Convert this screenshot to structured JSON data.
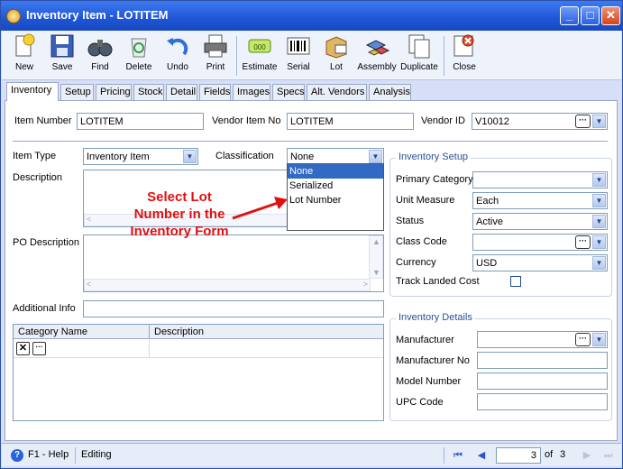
{
  "window": {
    "title": "Inventory Item - LOTITEM",
    "minimize_glyph": "_",
    "maximize_glyph": "□",
    "close_glyph": "✕"
  },
  "toolbar": {
    "new": "New",
    "save": "Save",
    "find": "Find",
    "delete": "Delete",
    "undo": "Undo",
    "print": "Print",
    "estimate": "Estimate",
    "serial": "Serial",
    "lot": "Lot",
    "assembly": "Assembly",
    "duplicate": "Duplicate",
    "close": "Close"
  },
  "tabs": [
    "Inventory",
    "Setup",
    "Pricing",
    "Stock",
    "Detail",
    "Fields",
    "Images",
    "Specs",
    "Alt. Vendors",
    "Analysis"
  ],
  "header_fields": {
    "item_number_label": "Item Number",
    "item_number_value": "LOTITEM",
    "vendor_item_no_label": "Vendor Item No",
    "vendor_item_no_value": "LOTITEM",
    "vendor_id_label": "Vendor ID",
    "vendor_id_value": "V10012"
  },
  "left_form": {
    "item_type_label": "Item Type",
    "item_type_value": "Inventory Item",
    "classification_label": "Classification",
    "classification_value": "None",
    "classification_options": [
      "None",
      "Serialized",
      "Lot Number"
    ],
    "description_label": "Description",
    "po_description_label": "PO Description",
    "additional_info_label": "Additional Info"
  },
  "annotation": {
    "line1": "Select Lot",
    "line2": "Number in the",
    "line3": "Inventory Form"
  },
  "category_grid": {
    "col_category_name": "Category Name",
    "col_description": "Description",
    "remove_glyph": "✕",
    "browse_glyph": "···"
  },
  "inventory_setup": {
    "title": "Inventory Setup",
    "primary_category_label": "Primary Category",
    "primary_category_value": "",
    "unit_measure_label": "Unit Measure",
    "unit_measure_value": "Each",
    "status_label": "Status",
    "status_value": "Active",
    "class_code_label": "Class Code",
    "class_code_value": "",
    "currency_label": "Currency",
    "currency_value": "USD",
    "track_landed_cost_label": "Track Landed Cost",
    "track_landed_cost_checked": false
  },
  "inventory_details": {
    "title": "Inventory Details",
    "manufacturer_label": "Manufacturer",
    "manufacturer_no_label": "Manufacturer No",
    "model_number_label": "Model Number",
    "upc_code_label": "UPC Code"
  },
  "statusbar": {
    "help": "F1 - Help",
    "mode": "Editing",
    "current_page": "3",
    "of_label": "of",
    "total_pages": "3"
  },
  "colors": {
    "titlebar": "#1f56d6",
    "annotation": "#e11010",
    "group_title": "#2a4f9a",
    "selection": "#316ac5"
  }
}
